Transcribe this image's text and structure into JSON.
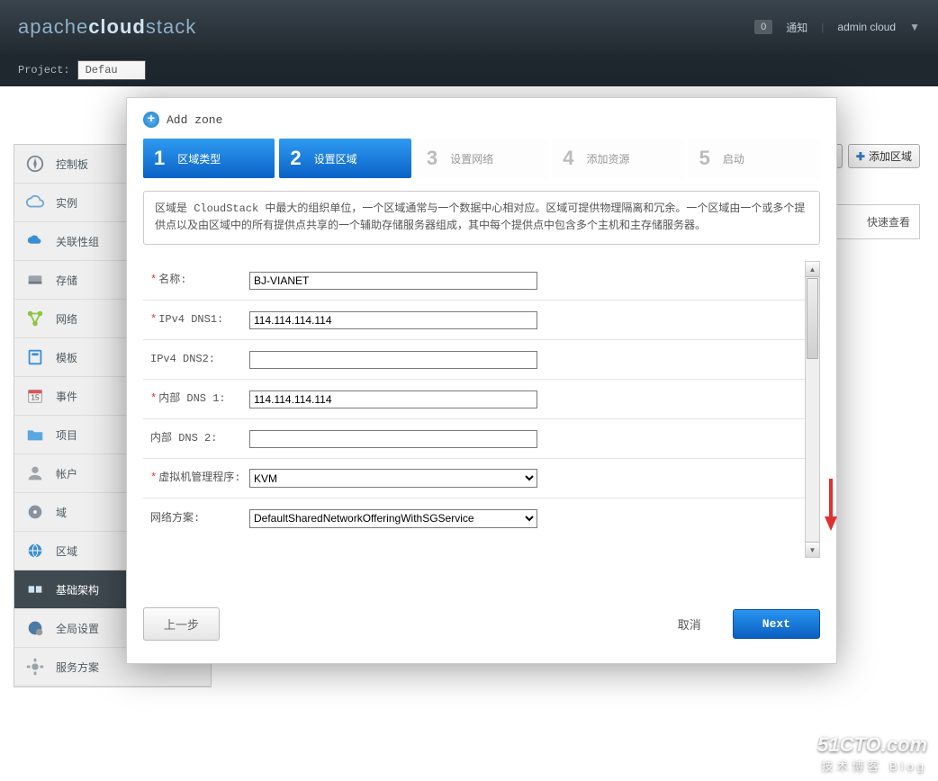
{
  "header": {
    "logo_apache": "apache",
    "logo_cloud": "cloud",
    "logo_stack": "stack",
    "notif_badge": "0",
    "notif_label": "通知",
    "user": "admin cloud"
  },
  "project_bar": {
    "label": "Project:",
    "selected": "Defau"
  },
  "sidebar": [
    {
      "key": "dashboard",
      "label": "控制板"
    },
    {
      "key": "instances",
      "label": "实例"
    },
    {
      "key": "affinity",
      "label": "关联性组"
    },
    {
      "key": "storage",
      "label": "存储"
    },
    {
      "key": "network",
      "label": "网络"
    },
    {
      "key": "templates",
      "label": "模板"
    },
    {
      "key": "events",
      "label": "事件"
    },
    {
      "key": "projects",
      "label": "项目"
    },
    {
      "key": "accounts",
      "label": "帐户"
    },
    {
      "key": "domains",
      "label": "域"
    },
    {
      "key": "regions",
      "label": "区域"
    },
    {
      "key": "infrastructure",
      "label": "基础架构"
    },
    {
      "key": "global",
      "label": "全局设置"
    },
    {
      "key": "offerings",
      "label": "服务方案"
    }
  ],
  "toolbar": {
    "add_zone": "添加区域",
    "quick_view": "快速查看"
  },
  "modal": {
    "title": "Add zone",
    "steps": [
      {
        "num": "1",
        "label": "区域类型",
        "active": true
      },
      {
        "num": "2",
        "label": "设置区域",
        "active": true
      },
      {
        "num": "3",
        "label": "设置网络",
        "active": false
      },
      {
        "num": "4",
        "label": "添加资源",
        "active": false
      },
      {
        "num": "5",
        "label": "启动",
        "active": false
      }
    ],
    "description": "区域是 CloudStack 中最大的组织单位，一个区域通常与一个数据中心相对应。区域可提供物理隔离和冗余。一个区域由一个或多个提供点以及由区域中的所有提供点共享的一个辅助存储服务器组成，其中每个提供点中包含多个主机和主存储服务器。",
    "fields": {
      "name": {
        "label": "名称:",
        "required": true,
        "value": "BJ-VIANET"
      },
      "dns1": {
        "label": "IPv4 DNS1:",
        "required": true,
        "value": "114.114.114.114"
      },
      "dns2": {
        "label": "IPv4 DNS2:",
        "required": false,
        "value": ""
      },
      "internal_dns1": {
        "label": "内部 DNS 1:",
        "required": true,
        "value": "114.114.114.114"
      },
      "internal_dns2": {
        "label": "内部 DNS 2:",
        "required": false,
        "value": ""
      },
      "hypervisor": {
        "label": "虚拟机管理程序:",
        "required": true,
        "value": "KVM"
      },
      "network_offering": {
        "label": "网络方案:",
        "required": false,
        "value": "DefaultSharedNetworkOfferingWithSGService"
      }
    },
    "buttons": {
      "prev": "上一步",
      "cancel": "取消",
      "next": "Next"
    }
  },
  "watermark": {
    "line1": "51CTO.com",
    "line2": "技术博客  Blog"
  }
}
